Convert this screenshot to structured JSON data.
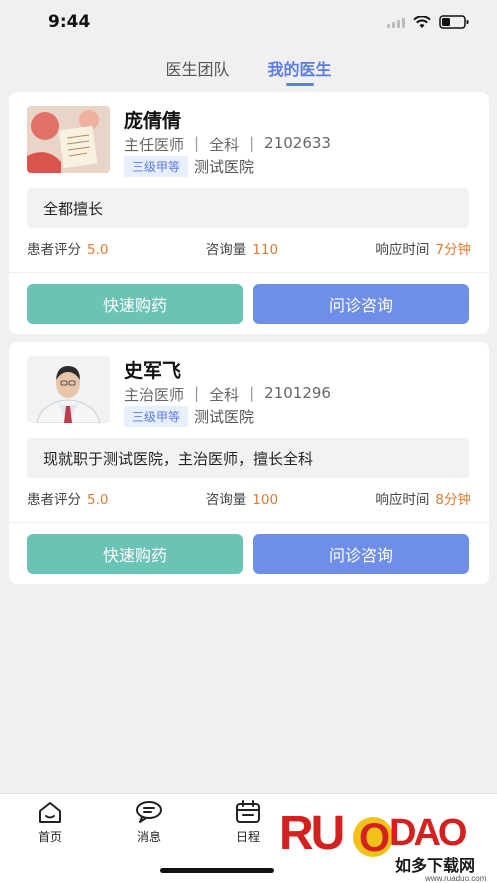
{
  "status_bar": {
    "time": "9:44"
  },
  "tabs": [
    {
      "label": "医生团队",
      "active": false
    },
    {
      "label": "我的医生",
      "active": true
    }
  ],
  "doctors": [
    {
      "name": "庞倩倩",
      "title": "主任医师",
      "department": "全科",
      "id": "2102633",
      "hospital_level": "三级甲等",
      "hospital": "测试医院",
      "intro": "全都擅长",
      "rating_label": "患者评分",
      "rating": "5.0",
      "consult_label": "咨询量",
      "consult_count": "110",
      "response_label": "响应时间",
      "response_time": "7分钟",
      "buy_label": "快速购药",
      "consult_button": "问诊咨询"
    },
    {
      "name": "史军飞",
      "title": "主治医师",
      "department": "全科",
      "id": "2101296",
      "hospital_level": "三级甲等",
      "hospital": "测试医院",
      "intro": "现就职于测试医院，主治医师，擅长全科",
      "rating_label": "患者评分",
      "rating": "5.0",
      "consult_label": "咨询量",
      "consult_count": "100",
      "response_label": "响应时间",
      "response_time": "8分钟",
      "buy_label": "快速购药",
      "consult_button": "问诊咨询"
    }
  ],
  "tabbar": [
    {
      "label": "首页",
      "icon": "home-icon"
    },
    {
      "label": "消息",
      "icon": "message-icon"
    },
    {
      "label": "日程",
      "icon": "calendar-icon"
    }
  ],
  "watermark": {
    "brand": "RUAODAO",
    "text": "如多下载网",
    "url": "www.ruaduo.com"
  },
  "colors": {
    "accent": "#5b7de6",
    "buy": "#6ac3b5",
    "consult": "#6f8ee8",
    "highlight": "#e07a30"
  }
}
